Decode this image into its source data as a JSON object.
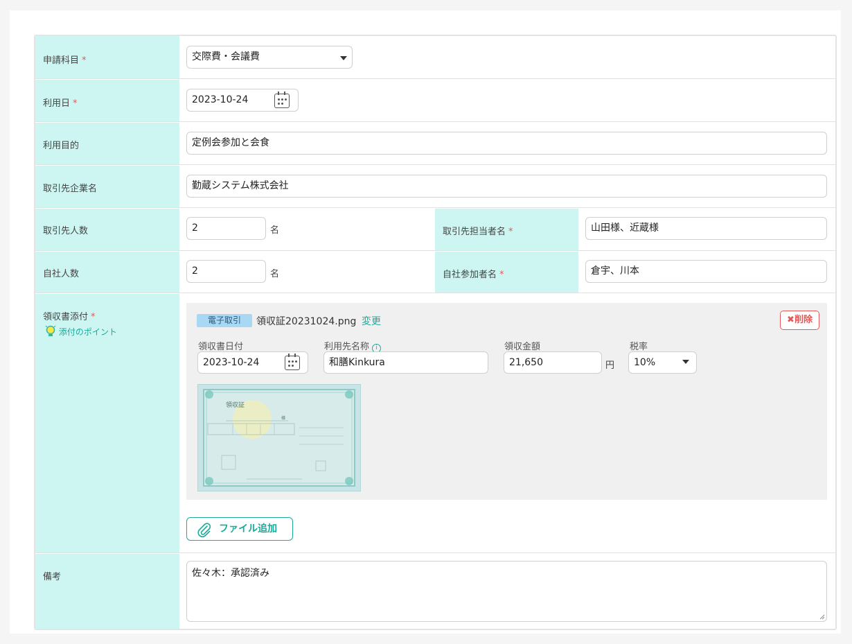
{
  "fields": {
    "category": {
      "label": "申請科目",
      "required": "*",
      "value": "交際費・会議費"
    },
    "use_date": {
      "label": "利用日",
      "required": "*",
      "value": "2023-10-24"
    },
    "purpose": {
      "label": "利用目的",
      "value": "定例会参加と会食"
    },
    "client_company": {
      "label": "取引先企業名",
      "value": "勤蔵システム株式会社"
    },
    "client_count": {
      "label": "取引先人数",
      "value": "2",
      "unit": "名"
    },
    "client_contact": {
      "label": "取引先担当者名",
      "required": "*",
      "value": "山田様、近蔵様"
    },
    "own_count": {
      "label": "自社人数",
      "value": "2",
      "unit": "名"
    },
    "own_participants": {
      "label": "自社参加者名",
      "required": "*",
      "value": "倉宇、川本"
    },
    "notes": {
      "label": "備考",
      "value": "佐々木：承認済み"
    }
  },
  "receipt": {
    "label": "領収書添付",
    "required": "*",
    "hint": "添付のポイント",
    "badge": "電子取引",
    "filename": "領収証20231024.png",
    "change_link": "変更",
    "delete_button": "削除",
    "date_label": "領収書日付",
    "date_value": "2023-10-24",
    "vendor_label": "利用先名称",
    "vendor_value": "和膳Kinkura",
    "amount_label": "領収金額",
    "amount_value": "21,650",
    "amount_unit": "円",
    "tax_label": "税率",
    "tax_value": "10%",
    "add_file_button": "ファイル追加",
    "thumbnail": {
      "title": "領収証",
      "honorific": "様"
    }
  },
  "colors": {
    "label_bg": "#cdf6f2",
    "accent": "#1aaa9a",
    "required": "#e05a5a",
    "badge_bg": "#a9d8f5"
  }
}
